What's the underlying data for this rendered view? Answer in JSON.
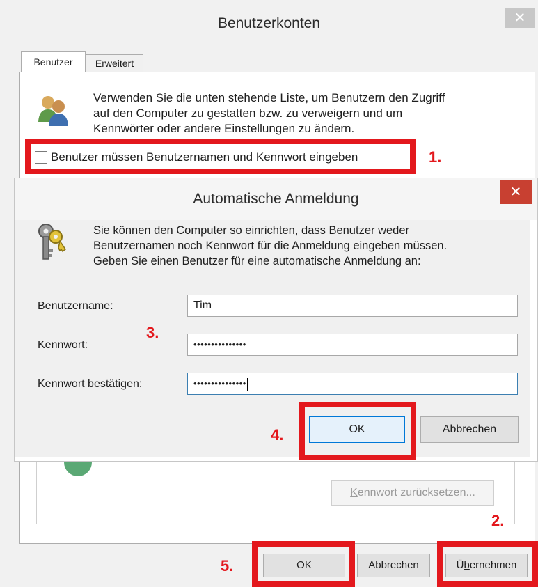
{
  "outer_dialog": {
    "title": "Benutzerkonten",
    "close_glyph": "✕",
    "tabs": [
      {
        "label": "Benutzer",
        "active": true
      },
      {
        "label": "Erweitert",
        "active": false
      }
    ],
    "intro_line1": "Verwenden Sie die unten stehende Liste, um Benutzern den Zugriff",
    "intro_line2": "auf den Computer zu gestatten bzw. zu verweigern und um",
    "intro_line3": "Kennwörter oder andere Einstellungen zu ändern.",
    "checkbox_label_pre": "Ben",
    "checkbox_label_accel": "u",
    "checkbox_label_post": "tzer müssen Benutzernamen und Kennwort eingeben",
    "checkbox_checked": false,
    "reset_button_accel": "K",
    "reset_button_rest": "ennwort zurücksetzen...",
    "buttons": {
      "ok": "OK",
      "cancel": "Abbrechen",
      "apply_pre": "Ü",
      "apply_accel": "b",
      "apply_post": "ernehmen"
    }
  },
  "inner_dialog": {
    "title": "Automatische Anmeldung",
    "close_glyph": "✕",
    "info_line1": "Sie können den Computer so einrichten, dass Benutzer weder",
    "info_line2": "Benutzernamen noch Kennwort für die Anmeldung eingeben müssen.",
    "info_line3": "Geben Sie einen Benutzer für eine automatische Anmeldung an:",
    "fields": {
      "username_label": "Benutzername:",
      "username_value": "Tim",
      "password_label": "Kennwort:",
      "password_value": "•••••••••••••••",
      "confirm_label": "Kennwort bestätigen:",
      "confirm_value": "•••••••••••••••"
    },
    "buttons": {
      "ok": "OK",
      "cancel": "Abbrechen"
    }
  },
  "annotations": {
    "step1": "1.",
    "step2": "2.",
    "step3": "3.",
    "step4": "4.",
    "step5": "5.",
    "color": "#e3181d"
  },
  "icons": [
    "users-icon",
    "keys-icon",
    "close-icon"
  ]
}
